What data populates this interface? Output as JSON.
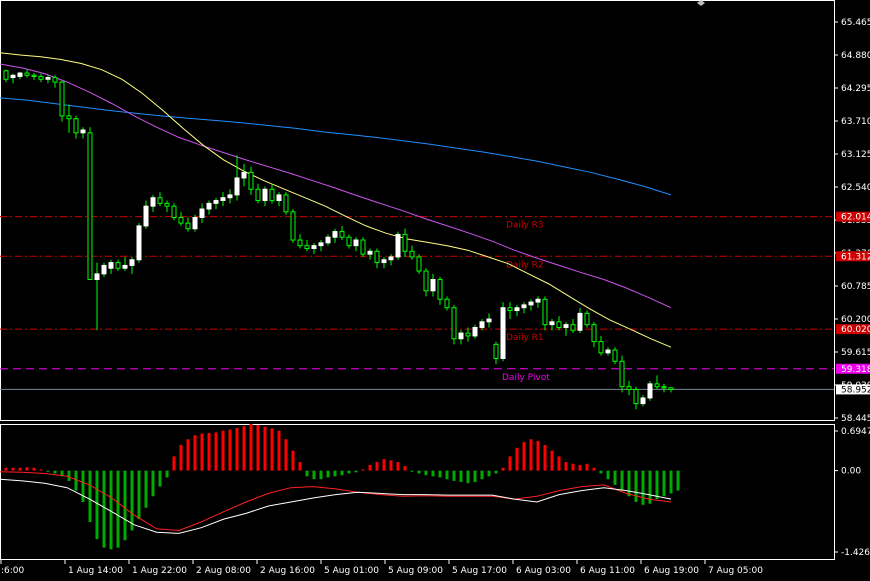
{
  "colors": {
    "background": "#000000",
    "bull_candle": "#ffffff",
    "bear_candle": "#00ff00",
    "wick": "#00ff00",
    "ma_fast": "#ffff80",
    "ma_mid": "#cc55ee",
    "ma_slow": "#1e90ff",
    "pivot_line": "#ee00ee",
    "r_lines": "#cc0000",
    "macd_pos": "#ff0000",
    "macd_neg": "#00aa00",
    "signal_white": "#ffffff",
    "signal_red": "#ff2020",
    "axis_text": "#ffffff",
    "frame": "#ffffff"
  },
  "chart_data": {
    "type": "candlestick",
    "price_axis": {
      "ticks": [
        "65.465",
        "64.880",
        "64.295",
        "63.710",
        "63.125",
        "62.540",
        "61.955",
        "61.370",
        "60.785",
        "60.200",
        "59.615",
        "59.030",
        "58.445"
      ],
      "min": 58.445,
      "max": 65.465
    },
    "time_axis": {
      "labels": [
        ":6:00",
        "1 Aug 14:00",
        "1 Aug 22:00",
        "2 Aug 08:00",
        "2 Aug 16:00",
        "5 Aug 01:00",
        "5 Aug 09:00",
        "5 Aug 17:00",
        "6 Aug 03:00",
        "6 Aug 11:00",
        "6 Aug 19:00",
        "7 Aug 05:00"
      ]
    },
    "levels": [
      {
        "name": "Daily R3",
        "value": 62.014,
        "tag": "62.014"
      },
      {
        "name": "Daily R2",
        "value": 61.312,
        "tag": "61.312"
      },
      {
        "name": "Daily R1",
        "value": 60.02,
        "tag": "60.020"
      },
      {
        "name": "Daily Pivot",
        "value": 59.318,
        "tag": "59.318"
      }
    ],
    "current_price": {
      "value": 58.952,
      "tag": "58.952"
    },
    "macd_axis": {
      "ticks": [
        "0.69476",
        "0.00",
        "-1.42695"
      ],
      "min": -1.42695,
      "max": 0.69476
    },
    "ohlc": [
      [
        64.6,
        64.62,
        64.4,
        64.45
      ],
      [
        64.48,
        64.55,
        64.38,
        64.52
      ],
      [
        64.5,
        64.58,
        64.45,
        64.56
      ],
      [
        64.56,
        64.62,
        64.48,
        64.52
      ],
      [
        64.52,
        64.56,
        64.44,
        64.5
      ],
      [
        64.5,
        64.55,
        64.4,
        64.45
      ],
      [
        64.45,
        64.52,
        64.38,
        64.48
      ],
      [
        64.48,
        64.52,
        64.3,
        64.4
      ],
      [
        64.4,
        64.42,
        63.7,
        63.8
      ],
      [
        63.8,
        64.0,
        63.5,
        63.75
      ],
      [
        63.75,
        63.8,
        63.4,
        63.5
      ],
      [
        63.5,
        63.6,
        63.4,
        63.55
      ],
      [
        63.5,
        63.6,
        62.0,
        60.9
      ],
      [
        60.9,
        61.2,
        60.0,
        61.0
      ],
      [
        61.0,
        61.2,
        60.95,
        61.15
      ],
      [
        61.1,
        61.25,
        61.0,
        61.2
      ],
      [
        61.2,
        61.25,
        61.05,
        61.1
      ],
      [
        61.1,
        61.3,
        61.05,
        61.15
      ],
      [
        61.15,
        61.3,
        61.0,
        61.25
      ],
      [
        61.25,
        61.9,
        61.2,
        61.85
      ],
      [
        61.85,
        62.3,
        61.8,
        62.2
      ],
      [
        62.2,
        62.4,
        62.1,
        62.35
      ],
      [
        62.35,
        62.45,
        62.2,
        62.25
      ],
      [
        62.25,
        62.3,
        62.1,
        62.2
      ],
      [
        62.2,
        62.25,
        61.95,
        62.0
      ],
      [
        62.0,
        62.1,
        61.85,
        61.9
      ],
      [
        61.9,
        62.0,
        61.75,
        61.8
      ],
      [
        61.8,
        62.05,
        61.75,
        62.0
      ],
      [
        62.0,
        62.25,
        61.9,
        62.15
      ],
      [
        62.15,
        62.3,
        62.05,
        62.25
      ],
      [
        62.25,
        62.35,
        62.15,
        62.3
      ],
      [
        62.3,
        62.45,
        62.2,
        62.35
      ],
      [
        62.35,
        62.5,
        62.25,
        62.4
      ],
      [
        62.4,
        63.1,
        62.3,
        62.7
      ],
      [
        62.7,
        62.95,
        62.55,
        62.8
      ],
      [
        62.8,
        62.9,
        62.4,
        62.5
      ],
      [
        62.5,
        62.6,
        62.25,
        62.3
      ],
      [
        62.3,
        62.55,
        62.2,
        62.5
      ],
      [
        62.5,
        62.6,
        62.25,
        62.3
      ],
      [
        62.3,
        62.45,
        62.2,
        62.4
      ],
      [
        62.4,
        62.45,
        62.05,
        62.1
      ],
      [
        62.1,
        62.15,
        61.55,
        61.6
      ],
      [
        61.6,
        61.7,
        61.45,
        61.5
      ],
      [
        61.5,
        61.6,
        61.4,
        61.45
      ],
      [
        61.45,
        61.55,
        61.35,
        61.5
      ],
      [
        61.5,
        61.6,
        61.4,
        61.55
      ],
      [
        61.55,
        61.7,
        61.5,
        61.65
      ],
      [
        61.65,
        61.8,
        61.55,
        61.75
      ],
      [
        61.75,
        61.85,
        61.6,
        61.65
      ],
      [
        61.65,
        61.7,
        61.45,
        61.5
      ],
      [
        61.5,
        61.65,
        61.4,
        61.6
      ],
      [
        61.6,
        61.65,
        61.3,
        61.35
      ],
      [
        61.35,
        61.45,
        61.25,
        61.4
      ],
      [
        61.4,
        61.45,
        61.1,
        61.2
      ],
      [
        61.2,
        61.3,
        61.1,
        61.25
      ],
      [
        61.25,
        61.35,
        61.15,
        61.3
      ],
      [
        61.3,
        61.75,
        61.25,
        61.7
      ],
      [
        61.7,
        61.8,
        61.3,
        61.4
      ],
      [
        61.4,
        61.5,
        61.25,
        61.3
      ],
      [
        61.3,
        61.35,
        61.0,
        61.05
      ],
      [
        61.05,
        61.1,
        60.6,
        60.7
      ],
      [
        60.7,
        61.0,
        60.6,
        60.9
      ],
      [
        60.9,
        60.95,
        60.45,
        60.55
      ],
      [
        60.55,
        60.6,
        60.35,
        60.4
      ],
      [
        60.4,
        60.45,
        59.75,
        59.85
      ],
      [
        59.85,
        60.0,
        59.75,
        59.95
      ],
      [
        59.95,
        60.05,
        59.8,
        59.9
      ],
      [
        59.9,
        60.1,
        59.85,
        60.05
      ],
      [
        60.05,
        60.2,
        60.0,
        60.15
      ],
      [
        60.15,
        60.3,
        60.05,
        60.2
      ],
      [
        59.75,
        59.8,
        59.4,
        59.5
      ],
      [
        59.5,
        60.5,
        59.45,
        60.4
      ],
      [
        60.4,
        60.5,
        60.2,
        60.35
      ],
      [
        60.35,
        60.45,
        60.25,
        60.4
      ],
      [
        60.4,
        60.5,
        60.3,
        60.45
      ],
      [
        60.45,
        60.55,
        60.35,
        60.5
      ],
      [
        60.5,
        60.6,
        60.4,
        60.55
      ],
      [
        60.55,
        60.6,
        60.0,
        60.1
      ],
      [
        60.1,
        60.2,
        60.0,
        60.15
      ],
      [
        60.15,
        60.25,
        60.0,
        60.05
      ],
      [
        60.05,
        60.15,
        59.9,
        60.1
      ],
      [
        60.1,
        60.2,
        59.95,
        60.0
      ],
      [
        60.0,
        60.4,
        59.95,
        60.3
      ],
      [
        60.3,
        60.35,
        60.05,
        60.1
      ],
      [
        60.1,
        60.15,
        59.7,
        59.8
      ],
      [
        59.8,
        59.9,
        59.55,
        59.6
      ],
      [
        59.6,
        59.7,
        59.55,
        59.65
      ],
      [
        59.65,
        59.7,
        59.4,
        59.45
      ],
      [
        59.45,
        59.55,
        58.9,
        59.0
      ],
      [
        59.0,
        59.1,
        58.85,
        58.95
      ],
      [
        58.95,
        59.0,
        58.6,
        58.7
      ],
      [
        58.7,
        58.85,
        58.65,
        58.8
      ],
      [
        58.8,
        59.1,
        58.75,
        59.05
      ],
      [
        59.05,
        59.2,
        58.95,
        59.0
      ],
      [
        59.0,
        59.05,
        58.9,
        58.98
      ],
      [
        58.98,
        59.0,
        58.9,
        58.95
      ]
    ],
    "ma_fast": [
      64.92,
      64.88,
      64.85,
      64.8,
      64.73,
      64.62,
      64.45,
      64.2,
      63.9,
      63.58,
      63.28,
      63.02,
      62.82,
      62.65,
      62.5,
      62.35,
      62.2,
      62.02,
      61.85,
      61.72,
      61.62,
      61.56,
      61.5,
      61.42,
      61.3,
      61.18,
      61.0,
      60.82,
      60.6,
      60.38,
      60.18,
      60.02,
      59.85,
      59.7
    ],
    "ma_mid": [
      64.72,
      64.65,
      64.55,
      64.4,
      64.22,
      64.02,
      63.8,
      63.6,
      63.42,
      63.28,
      63.15,
      63.02,
      62.9,
      62.78,
      62.65,
      62.52,
      62.38,
      62.25,
      62.12,
      61.98,
      61.85,
      61.72,
      61.58,
      61.42,
      61.28,
      61.15,
      61.02,
      60.9,
      60.75,
      60.58,
      60.4
    ],
    "ma_slow": [
      64.12,
      64.08,
      64.02,
      63.96,
      63.9,
      63.85,
      63.8,
      63.76,
      63.72,
      63.68,
      63.63,
      63.58,
      63.52,
      63.47,
      63.42,
      63.36,
      63.3,
      63.23,
      63.16,
      63.08,
      63.0,
      62.9,
      62.8,
      62.68,
      62.55,
      62.4
    ],
    "macd_hist": [
      0.05,
      0.05,
      0.05,
      0.06,
      0.05,
      0.02,
      -0.02,
      -0.05,
      -0.1,
      -0.18,
      -0.35,
      -0.55,
      -0.9,
      -1.2,
      -1.35,
      -1.38,
      -1.35,
      -1.22,
      -1.05,
      -0.85,
      -0.65,
      -0.45,
      -0.28,
      -0.12,
      0.25,
      0.45,
      0.55,
      0.62,
      0.65,
      0.66,
      0.67,
      0.7,
      0.72,
      0.75,
      0.78,
      0.82,
      0.8,
      0.77,
      0.74,
      0.7,
      0.55,
      0.35,
      0.15,
      -0.1,
      -0.15,
      -0.15,
      -0.12,
      -0.1,
      -0.08,
      -0.05,
      -0.03,
      0.02,
      0.1,
      0.15,
      0.2,
      0.18,
      0.15,
      0.08,
      -0.02,
      -0.05,
      -0.08,
      -0.1,
      -0.12,
      -0.15,
      -0.18,
      -0.2,
      -0.22,
      -0.2,
      -0.15,
      -0.1,
      -0.05,
      0.05,
      0.25,
      0.4,
      0.5,
      0.55,
      0.52,
      0.45,
      0.35,
      0.25,
      0.15,
      0.12,
      0.1,
      0.12,
      0.05,
      -0.05,
      -0.15,
      -0.25,
      -0.35,
      -0.45,
      -0.55,
      -0.6,
      -0.58,
      -0.5,
      -0.45,
      -0.4,
      -0.35
    ],
    "macd_signal_white": [
      -0.15,
      -0.18,
      -0.22,
      -0.3,
      -0.5,
      -0.72,
      -0.95,
      -1.08,
      -1.1,
      -1.0,
      -0.85,
      -0.75,
      -0.62,
      -0.55,
      -0.48,
      -0.42,
      -0.38,
      -0.4,
      -0.42,
      -0.42,
      -0.43,
      -0.43,
      -0.43,
      -0.5,
      -0.55,
      -0.42,
      -0.35,
      -0.3,
      -0.35,
      -0.42,
      -0.5
    ],
    "macd_signal_red": [
      -0.02,
      -0.03,
      -0.05,
      -0.1,
      -0.25,
      -0.48,
      -0.78,
      -1.02,
      -1.05,
      -0.9,
      -0.72,
      -0.55,
      -0.4,
      -0.3,
      -0.28,
      -0.32,
      -0.38,
      -0.42,
      -0.45,
      -0.44,
      -0.45,
      -0.45,
      -0.45,
      -0.5,
      -0.45,
      -0.35,
      -0.28,
      -0.25,
      -0.4,
      -0.5,
      -0.55
    ]
  }
}
